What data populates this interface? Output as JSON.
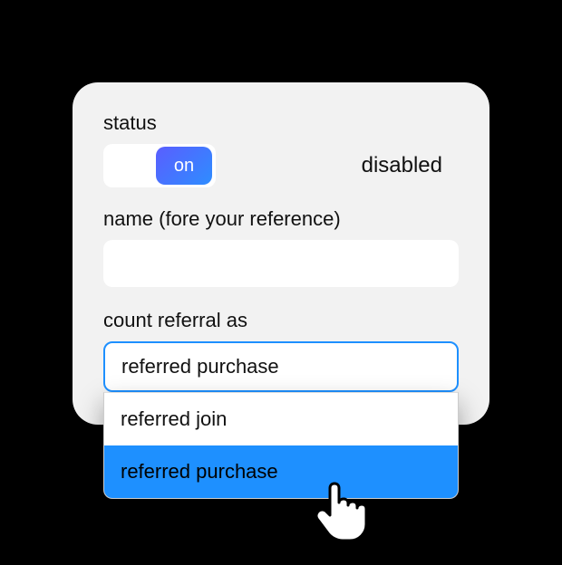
{
  "status": {
    "label": "status",
    "toggle_text": "on",
    "disabled_text": "disabled"
  },
  "name": {
    "label": "name (fore your reference)",
    "value": ""
  },
  "count_referral": {
    "label": "count referral as",
    "selected": "referred purchase",
    "options": [
      "referred join",
      "referred purchase"
    ]
  }
}
